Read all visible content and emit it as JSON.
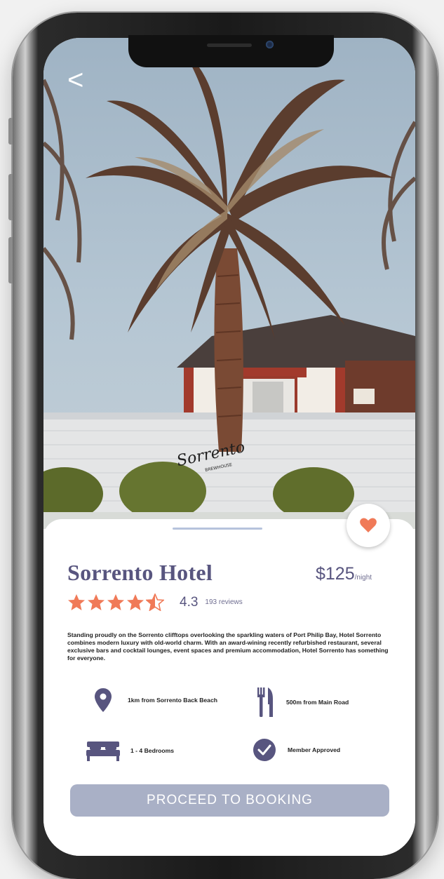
{
  "header": {
    "back_icon": "<"
  },
  "hotel": {
    "name": "Sorrento Hotel",
    "price": "$125",
    "price_unit": "/night",
    "rating": 4.3,
    "rating_display": "4.3",
    "reviews": "193 reviews",
    "photo_sign": "Sorrento",
    "photo_sign_sub": "BREWHOUSE",
    "description": "Standing proudly on the Sorrento clifftops overlooking the sparkling waters of Port Philip Bay, Hotel Sorrento combines modern luxury with old-world charm. With an award-wining recently refurbished restaurant, several exclusive bars and cocktail lounges, event spaces and premium accommodation, Hotel Sorrento has something for everyone."
  },
  "features": [
    {
      "icon": "location-pin-icon",
      "label": "1km from Sorrento Back Beach"
    },
    {
      "icon": "fork-knife-icon",
      "label": "500m from Main Road"
    },
    {
      "icon": "bed-icon",
      "label": "1 - 4 Bedrooms"
    },
    {
      "icon": "check-circle-icon",
      "label": "Member Approved"
    }
  ],
  "actions": {
    "book_label": "PROCEED TO BOOKING"
  },
  "colors": {
    "accent": "#f07a58",
    "primary": "#58557f",
    "button": "#a9b0c6"
  }
}
